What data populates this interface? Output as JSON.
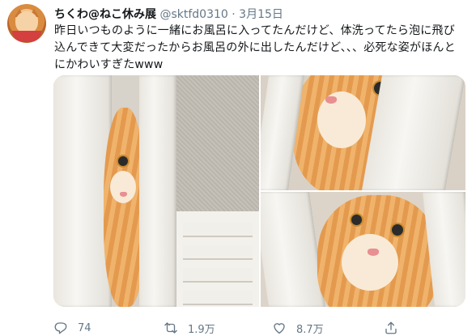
{
  "tweet": {
    "author_name": "ちくわ@ねこ休み展",
    "handle": "@sktfd0310",
    "separator": "·",
    "date": "3月15日",
    "text": "昨日いつものように一緒にお風呂に入ってたんだけど、体洗ってたら泡に飛び込んできて大変だったからお風呂の外に出したんだけど、、、必死な姿がほんとにかわいすぎたwww"
  },
  "actions": {
    "reply": {
      "icon": "reply-icon",
      "count": "74"
    },
    "retweet": {
      "icon": "retweet-icon",
      "count": "1.9万"
    },
    "like": {
      "icon": "heart-icon",
      "count": "8.7万"
    },
    "share": {
      "icon": "share-icon"
    }
  },
  "colors": {
    "text": "#14171a",
    "secondary": "#657786"
  }
}
